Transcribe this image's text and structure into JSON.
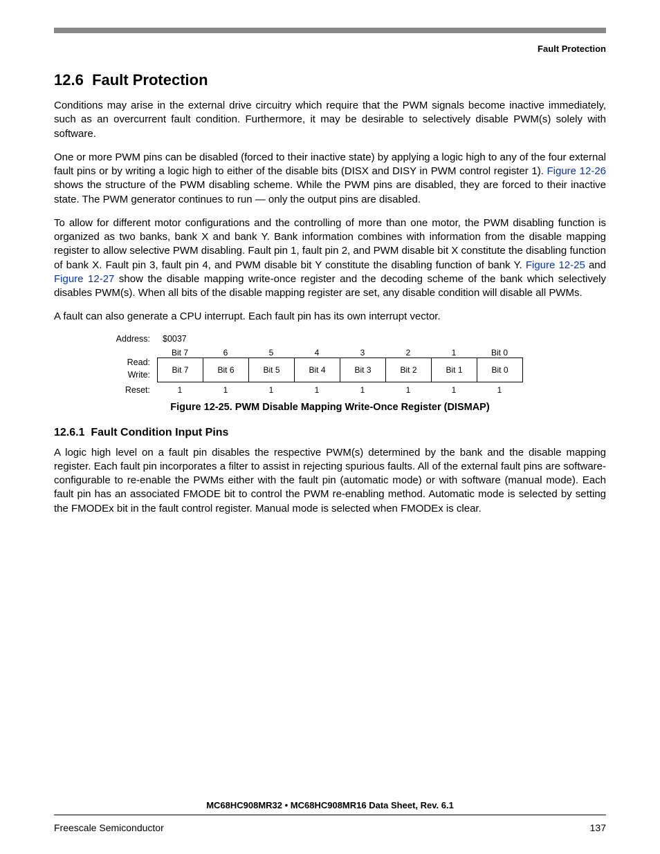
{
  "header": {
    "label": "Fault Protection"
  },
  "section": {
    "number": "12.6",
    "title": "Fault Protection"
  },
  "paragraphs": {
    "p1": "Conditions may arise in the external drive circuitry which require that the PWM signals become inactive immediately, such as an overcurrent fault condition. Furthermore, it may be desirable to selectively disable PWM(s) solely with software.",
    "p2_a": "One or more PWM pins can be disabled (forced to their inactive state) by applying a logic high to any of the four external fault pins or by writing a logic high to either of the disable bits (DISX and DISY in PWM control register 1). ",
    "p2_link1": "Figure 12-26",
    "p2_b": " shows the structure of the PWM disabling scheme. While the PWM pins are disabled, they are forced to their inactive state. The PWM generator continues to run — only the output pins are disabled.",
    "p3_a": "To allow for different motor configurations and the controlling of more than one motor, the PWM disabling function is organized as two banks, bank X and bank Y. Bank information combines with information from the disable mapping register to allow selective PWM disabling. Fault pin 1, fault pin 2, and PWM disable bit X constitute the disabling function of bank X. Fault pin 3, fault pin 4, and PWM disable bit Y constitute the disabling function of bank Y. ",
    "p3_link1": "Figure 12-25",
    "p3_mid": " and ",
    "p3_link2": "Figure 12-27",
    "p3_b": " show the disable mapping write-once register and the decoding scheme of the bank which selectively disables PWM(s). When all bits of the disable mapping register are set, any disable condition will disable all PWMs.",
    "p4": "A fault can also generate a CPU interrupt. Each fault pin has its own interrupt vector."
  },
  "register": {
    "address_label": "Address:",
    "address_value": "$0037",
    "read_label": "Read:",
    "write_label": "Write:",
    "reset_label": "Reset:",
    "bit_headers": [
      "Bit 7",
      "6",
      "5",
      "4",
      "3",
      "2",
      "1",
      "Bit 0"
    ],
    "bit_names": [
      "Bit 7",
      "Bit 6",
      "Bit 5",
      "Bit 4",
      "Bit 3",
      "Bit 2",
      "Bit 1",
      "Bit 0"
    ],
    "reset_values": [
      "1",
      "1",
      "1",
      "1",
      "1",
      "1",
      "1",
      "1"
    ],
    "caption": "Figure 12-25. PWM Disable Mapping Write-Once Register (DISMAP)"
  },
  "subsection": {
    "number": "12.6.1",
    "title": "Fault Condition Input Pins",
    "p1": "A logic high level on a fault pin disables the respective PWM(s) determined by the bank and the disable mapping register. Each fault pin incorporates a filter to assist in rejecting spurious faults. All of the external fault pins are software-configurable to re-enable the PWMs either with the fault pin (automatic mode) or with software (manual mode). Each fault pin has an associated FMODE bit to control the PWM re-enabling method. Automatic mode is selected by setting the FMODEx bit in the fault control register. Manual mode is selected when FMODEx is clear."
  },
  "footer": {
    "doc_title": "MC68HC908MR32 • MC68HC908MR16 Data Sheet, Rev. 6.1",
    "company": "Freescale Semiconductor",
    "page": "137"
  }
}
